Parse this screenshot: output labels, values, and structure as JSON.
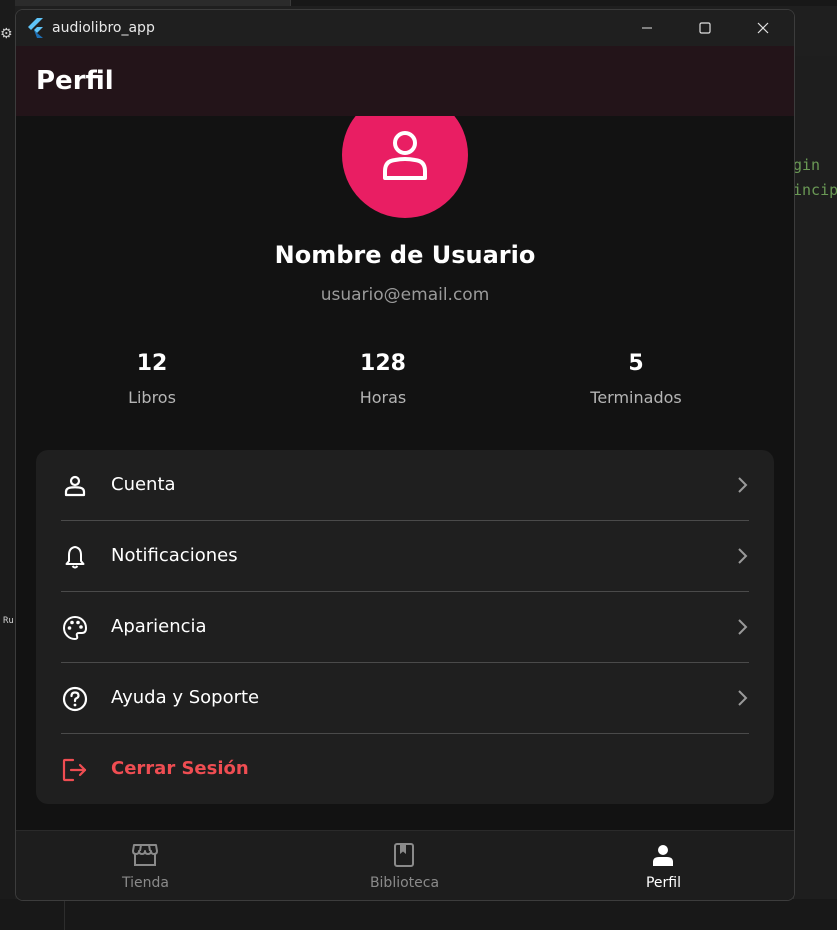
{
  "window": {
    "title": "audiolibro_app"
  },
  "appbar": {
    "title": "Perfil"
  },
  "profile": {
    "name": "Nombre de Usuario",
    "email": "usuario@email.com"
  },
  "stats": [
    {
      "value": "12",
      "label": "Libros"
    },
    {
      "value": "128",
      "label": "Horas"
    },
    {
      "value": "5",
      "label": "Terminados"
    }
  ],
  "menu": [
    {
      "label": "Cuenta",
      "icon": "person-icon"
    },
    {
      "label": "Notificaciones",
      "icon": "bell-icon"
    },
    {
      "label": "Apariencia",
      "icon": "palette-icon"
    },
    {
      "label": "Ayuda y Soporte",
      "icon": "help-icon"
    },
    {
      "label": "Cerrar Sesión",
      "icon": "logout-icon"
    }
  ],
  "nav": [
    {
      "label": "Tienda",
      "icon": "store-icon",
      "active": false
    },
    {
      "label": "Biblioteca",
      "icon": "book-icon",
      "active": false
    },
    {
      "label": "Perfil",
      "icon": "person-icon",
      "active": true
    }
  ],
  "background": {
    "code_line_1": "gin",
    "code_line_2": "incip",
    "side_label": "Ru"
  },
  "colors": {
    "accent": "#e91e63",
    "logout": "#ef4d52",
    "appbar": "#231419",
    "surface": "#1f1f1f",
    "background": "#121212"
  }
}
